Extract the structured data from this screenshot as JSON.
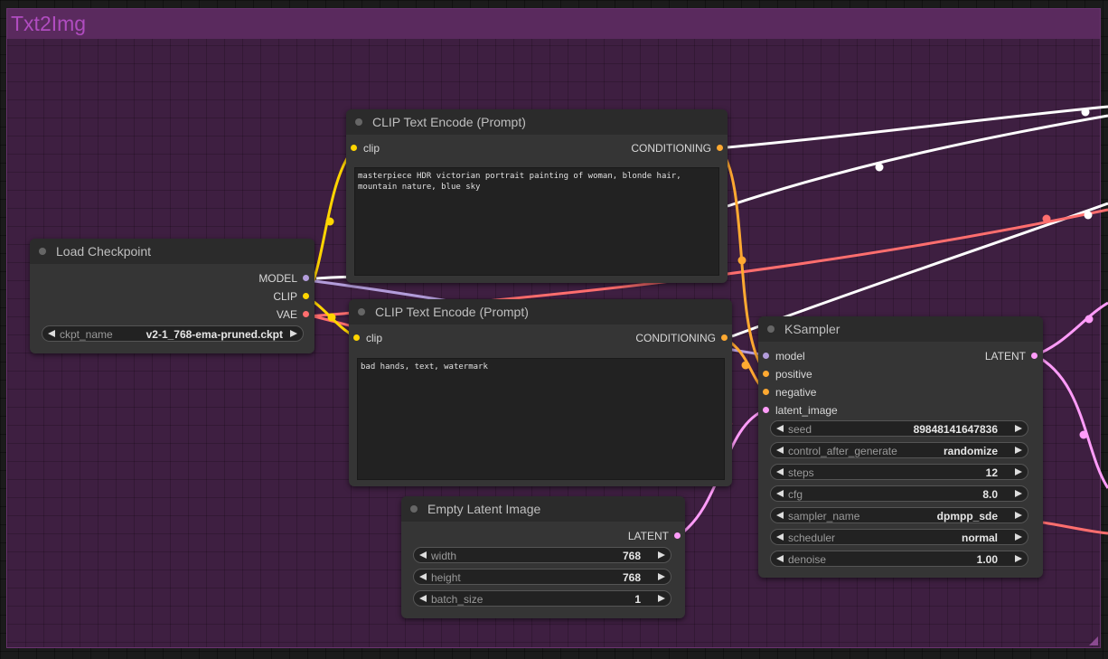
{
  "group": {
    "title": "Txt2Img"
  },
  "colors": {
    "clip": "#ffd500",
    "conditioning": "#ffa931",
    "model": "#b39ddb",
    "vae": "#ff6e6e",
    "latent": "#ff9cf9",
    "link_white": "#ffffff"
  },
  "nodes": {
    "load_checkpoint": {
      "title": "Load Checkpoint",
      "outputs": [
        "MODEL",
        "CLIP",
        "VAE"
      ],
      "widgets": [
        {
          "label": "ckpt_name",
          "value": "v2-1_768-ema-pruned.ckpt"
        }
      ]
    },
    "clip_pos": {
      "title": "CLIP Text Encode (Prompt)",
      "input": "clip",
      "output": "CONDITIONING",
      "text": "masterpiece HDR victorian portrait painting of woman, blonde hair, mountain nature, blue sky"
    },
    "clip_neg": {
      "title": "CLIP Text Encode (Prompt)",
      "input": "clip",
      "output": "CONDITIONING",
      "text": "bad hands, text, watermark"
    },
    "empty_latent": {
      "title": "Empty Latent Image",
      "output": "LATENT",
      "widgets": [
        {
          "label": "width",
          "value": "768"
        },
        {
          "label": "height",
          "value": "768"
        },
        {
          "label": "batch_size",
          "value": "1"
        }
      ]
    },
    "ksampler": {
      "title": "KSampler",
      "inputs": [
        "model",
        "positive",
        "negative",
        "latent_image"
      ],
      "output": "LATENT",
      "widgets": [
        {
          "label": "seed",
          "value": "89848141647836"
        },
        {
          "label": "control_after_generate",
          "value": "randomize"
        },
        {
          "label": "steps",
          "value": "12"
        },
        {
          "label": "cfg",
          "value": "8.0"
        },
        {
          "label": "sampler_name",
          "value": "dpmpp_sde"
        },
        {
          "label": "scheduler",
          "value": "normal"
        },
        {
          "label": "denoise",
          "value": "1.00"
        }
      ]
    }
  }
}
